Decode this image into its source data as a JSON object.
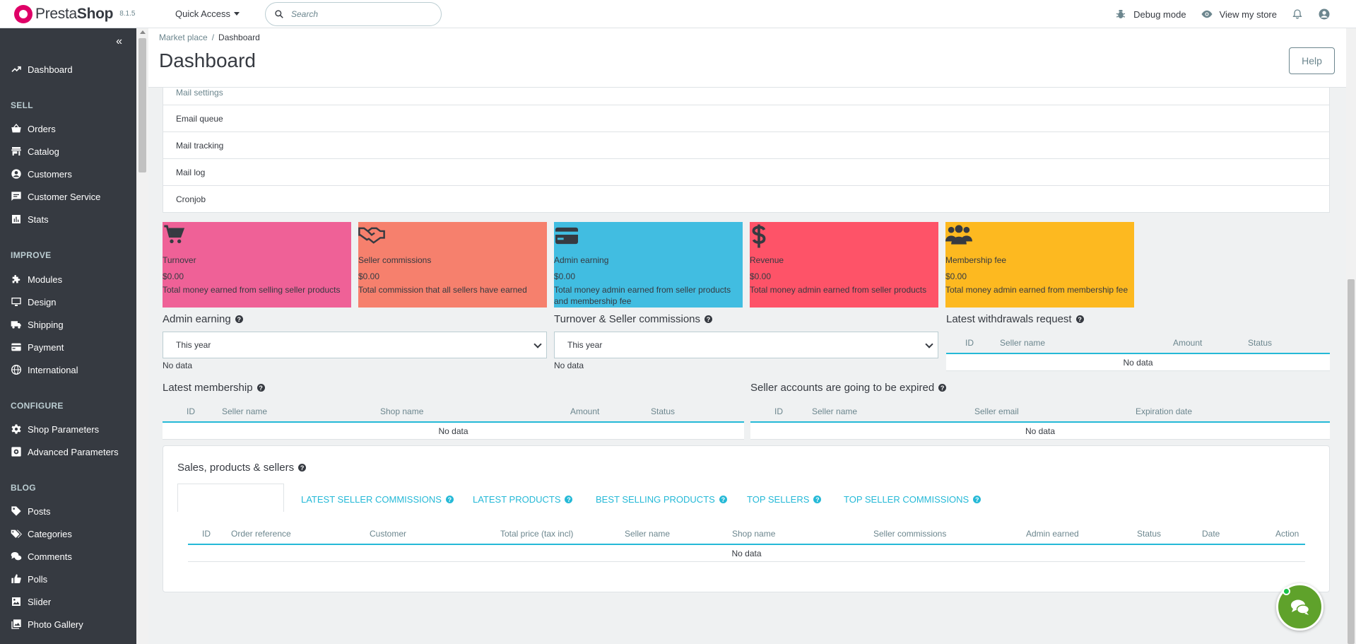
{
  "header": {
    "logo_text_a": "Presta",
    "logo_text_b": "Shop",
    "version": "8.1.5",
    "quick_access": "Quick Access",
    "search_placeholder": "Search",
    "debug_mode": "Debug mode",
    "view_store": "View my store"
  },
  "sidebar": {
    "items": [
      {
        "label": "Dashboard",
        "icon": "trending-up-icon"
      },
      {
        "section": "SELL"
      },
      {
        "label": "Orders",
        "icon": "basket-icon"
      },
      {
        "label": "Catalog",
        "icon": "store-icon"
      },
      {
        "label": "Customers",
        "icon": "account-circle-icon"
      },
      {
        "label": "Customer Service",
        "icon": "chat-icon"
      },
      {
        "label": "Stats",
        "icon": "bar-chart-icon"
      },
      {
        "section": "IMPROVE"
      },
      {
        "label": "Modules",
        "icon": "puzzle-icon"
      },
      {
        "label": "Design",
        "icon": "desktop-icon"
      },
      {
        "label": "Shipping",
        "icon": "truck-icon"
      },
      {
        "label": "Payment",
        "icon": "credit-card-icon"
      },
      {
        "label": "International",
        "icon": "globe-icon"
      },
      {
        "section": "CONFIGURE"
      },
      {
        "label": "Shop Parameters",
        "icon": "gear-icon"
      },
      {
        "label": "Advanced Parameters",
        "icon": "settings-applications-icon"
      },
      {
        "section": "BLOG"
      },
      {
        "label": "Posts",
        "icon": "tag-icon"
      },
      {
        "label": "Categories",
        "icon": "tags-icon"
      },
      {
        "label": "Comments",
        "icon": "comments-icon"
      },
      {
        "label": "Polls",
        "icon": "thumb-up-icon"
      },
      {
        "label": "Slider",
        "icon": "image-icon"
      },
      {
        "label": "Photo Gallery",
        "icon": "gallery-icon"
      }
    ]
  },
  "breadcrumb": {
    "parent": "Market place",
    "sep": "/",
    "current": "Dashboard"
  },
  "page": {
    "title": "Dashboard",
    "help": "Help"
  },
  "menu_list": [
    "Mail settings",
    "Email queue",
    "Mail tracking",
    "Mail log",
    "Cronjob"
  ],
  "stats": [
    {
      "label": "Turnover",
      "value": "$0.00",
      "desc": "Total money earned from selling seller products",
      "color": "#ef6197",
      "icon": "cart-icon"
    },
    {
      "label": "Seller commissions",
      "value": "$0.00",
      "desc": "Total commission that all sellers have earned",
      "color": "#f6806d",
      "icon": "handshake-icon"
    },
    {
      "label": "Admin earning",
      "value": "$0.00",
      "desc": "Total money admin earned from seller products and membership fee",
      "color": "#41bde1",
      "icon": "credit-card-icon"
    },
    {
      "label": "Revenue",
      "value": "$0.00",
      "desc": "Total money admin earned from seller products",
      "color": "#fe5368",
      "icon": "dollar-icon"
    },
    {
      "label": "Membership fee",
      "value": "$0.00",
      "desc": "Total money admin earned from membership fee",
      "color": "#fdb920",
      "icon": "users-icon"
    }
  ],
  "admin_earning": {
    "title": "Admin earning",
    "select": "This year",
    "no_data": "No data"
  },
  "turnover_commissions": {
    "title": "Turnover & Seller commissions",
    "select": "This year",
    "no_data": "No data"
  },
  "withdrawals": {
    "title": "Latest withdrawals request",
    "columns": [
      "ID",
      "Seller name",
      "Amount",
      "Status"
    ],
    "no_data": "No data"
  },
  "membership": {
    "title": "Latest membership",
    "columns": [
      "ID",
      "Seller name",
      "Shop name",
      "Amount",
      "Status"
    ],
    "no_data": "No data"
  },
  "expired": {
    "title": "Seller accounts are going to be expired",
    "columns": [
      "ID",
      "Seller name",
      "Seller email",
      "Expiration date"
    ],
    "no_data": "No data"
  },
  "sales_panel": {
    "title": "Sales, products & sellers",
    "tabs": [
      "LATEST SELLER COMMISSIONS",
      "LATEST PRODUCTS",
      "BEST SELLING PRODUCTS",
      "TOP SELLERS",
      "TOP SELLER COMMISSIONS"
    ],
    "columns": [
      "ID",
      "Order reference",
      "Customer",
      "Total price (tax incl)",
      "Seller name",
      "Shop name",
      "Seller commissions",
      "Admin earned",
      "Status",
      "Date",
      "Action"
    ],
    "no_data": "No data"
  },
  "colors": {
    "accent": "#25b9d7",
    "sidebar": "#363a41",
    "chat": "#5fa22b"
  }
}
